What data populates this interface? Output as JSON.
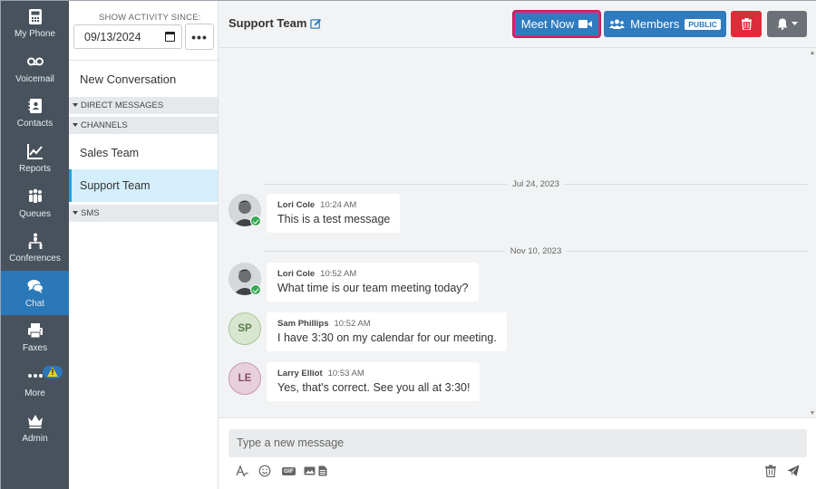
{
  "nav": [
    {
      "label": "My Phone",
      "icon": "phone-icon"
    },
    {
      "label": "Voicemail",
      "icon": "voicemail-icon"
    },
    {
      "label": "Contacts",
      "icon": "contacts-icon"
    },
    {
      "label": "Reports",
      "icon": "chart-icon"
    },
    {
      "label": "Queues",
      "icon": "queues-icon"
    },
    {
      "label": "Conferences",
      "icon": "conferences-icon"
    },
    {
      "label": "Chat",
      "icon": "chat-icon"
    },
    {
      "label": "Faxes",
      "icon": "fax-icon"
    },
    {
      "label": "More",
      "icon": "more-icon",
      "badge": "!"
    },
    {
      "label": "Admin",
      "icon": "crown-icon"
    }
  ],
  "activity": {
    "label": "SHOW ACTIVITY SINCE:",
    "date": "09/13/2024",
    "more": "•••"
  },
  "conversations": {
    "new_label": "New Conversation",
    "sections": {
      "direct": "DIRECT MESSAGES",
      "channels": "CHANNELS",
      "sms": "SMS"
    },
    "channels": [
      "Sales Team",
      "Support Team"
    ]
  },
  "header": {
    "title": "Support Team",
    "meet_label": "Meet Now",
    "members_label": "Members",
    "members_badge": "PUBLIC"
  },
  "messages": {
    "date1": "Jul 24, 2023",
    "date2": "Nov 10, 2023",
    "items": [
      {
        "author": "Lori Cole",
        "time": "10:24 AM",
        "text": "This is a test message"
      },
      {
        "author": "Lori Cole",
        "time": "10:52 AM",
        "text": "What time is our team meeting today?"
      },
      {
        "author": "Sam Phillips",
        "time": "10:52 AM",
        "text": "I have 3:30 on my calendar for our meeting.",
        "initials": "SP"
      },
      {
        "author": "Larry Elliot",
        "time": "10:53 AM",
        "text": "Yes, that's correct. See you all at 3:30!",
        "initials": "LE"
      }
    ]
  },
  "composer": {
    "placeholder": "Type a new message",
    "gif": "GIF"
  },
  "colors": {
    "nav_bg": "#48525c",
    "active": "#2a78b8",
    "primary": "#2f7bbf",
    "danger": "#dd2c3a"
  }
}
